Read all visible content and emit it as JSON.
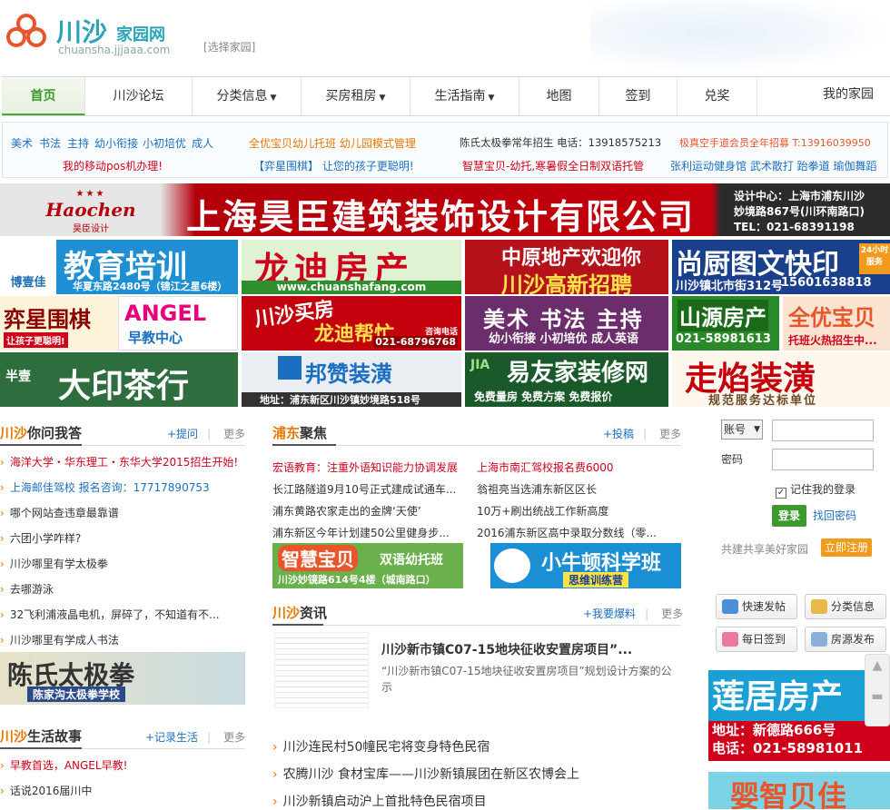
{
  "header": {
    "brand": "川沙",
    "brand_suffix": "家园网",
    "domain": "chuansha.jjjaaa.com",
    "select_home": "[选择家园]"
  },
  "nav": {
    "items": [
      {
        "label": "首页",
        "active": true
      },
      {
        "label": "川沙论坛"
      },
      {
        "label": "分类信息",
        "dropdown": true
      },
      {
        "label": "买房租房",
        "dropdown": true
      },
      {
        "label": "生活指南",
        "dropdown": true
      },
      {
        "label": "地图"
      },
      {
        "label": "签到"
      },
      {
        "label": "兑奖"
      }
    ],
    "my_home": "我的家园"
  },
  "quick_links": {
    "row1": [
      "美术",
      "书法",
      "主持",
      "幼小衔接",
      "小初培优",
      "成人"
    ],
    "row1_b": "全优宝贝幼儿托班  幼儿园模式管理",
    "row1_c": "陈氏太极拳常年招生  电话：13918575213",
    "row1_d": "极真空手道会员全年招募  T:13916039950",
    "row2_a": "我的移动pos机办理!",
    "row2_b": "【弈星围棋】 让您的孩子更聪明!",
    "row2_c": "智慧宝贝-幼托,寒暑假全日制双语托管",
    "row2_d": "张利运动健身馆  武术散打  跆拳道  瑜伽舞蹈"
  },
  "banners": {
    "big": {
      "logo": "Haochen",
      "logo_sub": "昊臣设计",
      "title": "上海昊臣建筑装饰设计有限公司",
      "line1": "设计中心：上海市浦东川沙",
      "line2": "妙境路867号(川环南路口)",
      "line3": "TEL：021-68391198"
    },
    "grid": [
      {
        "title": "教育培训",
        "sub": "华夏东路2480号（锦江之星6楼）",
        "brand": "博壹佳"
      },
      {
        "title": "龙迪房产",
        "sub": "www.chuanshafang.com"
      },
      {
        "title": "中原地产欢迎你",
        "sub": "川沙高新招聘"
      },
      {
        "title": "尚厨图文快印",
        "sub": "川沙镇北市街312号",
        "phone": "15601638818",
        "tag": "24小时服务"
      },
      {
        "title": "弈星围棋",
        "sub": "让孩子更聪明!"
      },
      {
        "title": "ANGEL",
        "sub": "早教中心"
      },
      {
        "title": "川沙买房",
        "sub": "龙迪帮忙",
        "phone": "021-68796768",
        "tag": "咨询电话"
      },
      {
        "title": "美术 书法 主持",
        "sub": "幼小衔接 小初培优 成人英语"
      },
      {
        "title": "山源房产",
        "phone": "021-58981613"
      },
      {
        "title": "全优宝贝",
        "sub": "托班火热招生中..."
      },
      {
        "title": "大印茶行",
        "brand": "半壹"
      },
      {
        "title": "邦赞装潢",
        "sub": "地址：浦东新区川沙镇妙境路518号"
      },
      {
        "title": "易友家装修网",
        "sub": "免费量房  免费方案  免费报价",
        "brand": "JIA"
      },
      {
        "title": "走焰装潢",
        "sub": "规范服务达标单位"
      }
    ]
  },
  "qa": {
    "title_hl": "川沙",
    "title": "你问我答",
    "ask": "+提问",
    "more": "更多",
    "items": [
      {
        "text": "海洋大学・华东理工・东华大学2015招生开始!",
        "style": "red"
      },
      {
        "text": "上海邮佳驾校   报名咨询：17717890753",
        "style": "blue"
      },
      {
        "text": "哪个网站查违章最靠谱"
      },
      {
        "text": "六团小学咋样?"
      },
      {
        "text": "川沙哪里有学太极拳"
      },
      {
        "text": "去哪游泳"
      },
      {
        "text": "32飞利浦液晶电机，屏碎了，不知道有不..."
      },
      {
        "text": "川沙哪里有学成人书法"
      }
    ],
    "ad_title": "陈氏太极拳",
    "ad_sub": "陈家沟太极拳学校"
  },
  "pudong": {
    "title_hl": "浦东",
    "title": "聚焦",
    "post": "+投稿",
    "more": "更多",
    "left": [
      {
        "text": "宏语教育：注重外语知识能力协调发展",
        "style": "red"
      },
      {
        "text": "长江路隧道9月10号正式建成试通车..."
      },
      {
        "text": "浦东黄路农家走出的金牌‘天使’"
      },
      {
        "text": "浦东新区今年计划建50公里健身步..."
      }
    ],
    "right": [
      {
        "text": "上海市南汇驾校报名费6000",
        "style": "red"
      },
      {
        "text": "翁祖亮当选浦东新区区长"
      },
      {
        "text": "10万+刷出统战工作新高度"
      },
      {
        "text": "2016浦东新区高中录取分数线（零..."
      }
    ],
    "ad1_title": "智慧宝贝",
    "ad1_tag": "双语幼托班",
    "ad1_sub": "川沙妙镜路614号4楼（城南路口）",
    "ad2_title": "小牛顿科学班",
    "ad2_sub": "思维训练营"
  },
  "news": {
    "title_hl": "川沙",
    "title": "资讯",
    "report": "+我要爆料",
    "more": "更多",
    "headline": "川沙新市镇C07-15地块征收安置房项目”...",
    "summary": "“川沙新市镇C07-15地块征收安置房项目”规划设计方案的公示",
    "items": [
      "川沙连民村50幢民宅将变身特色民宿",
      "农腾川沙 食材宝库——川沙新镇展团在新区农博会上",
      "川沙新镇启动沪上首批特色民宿项目"
    ]
  },
  "stories": {
    "title_hl": "川沙",
    "title": "生活故事",
    "record": "+记录生活",
    "more": "更多",
    "items": [
      {
        "text": "早教首选，ANGEL早教!",
        "style": "red"
      },
      {
        "text": "话说2016届川中"
      }
    ]
  },
  "login": {
    "account_type": "账号",
    "password_label": "密码",
    "remember": "记住我的登录",
    "login_btn": "登录",
    "forgot": "找回密码",
    "slogan": "共建共享美好家园",
    "register": "立即注册"
  },
  "quick_actions": [
    "快速发帖",
    "分类信息",
    "每日签到",
    "房源发布"
  ],
  "side_ads": [
    {
      "title": "莲居房产",
      "line1": "地址：新德路666号",
      "line2": "电话：021-58981011"
    },
    {
      "title": "婴智贝佳"
    }
  ],
  "colors": {
    "accent": "#3e9a2e",
    "orange": "#e87800",
    "link": "#1c6fc0",
    "red": "#d0021b"
  }
}
